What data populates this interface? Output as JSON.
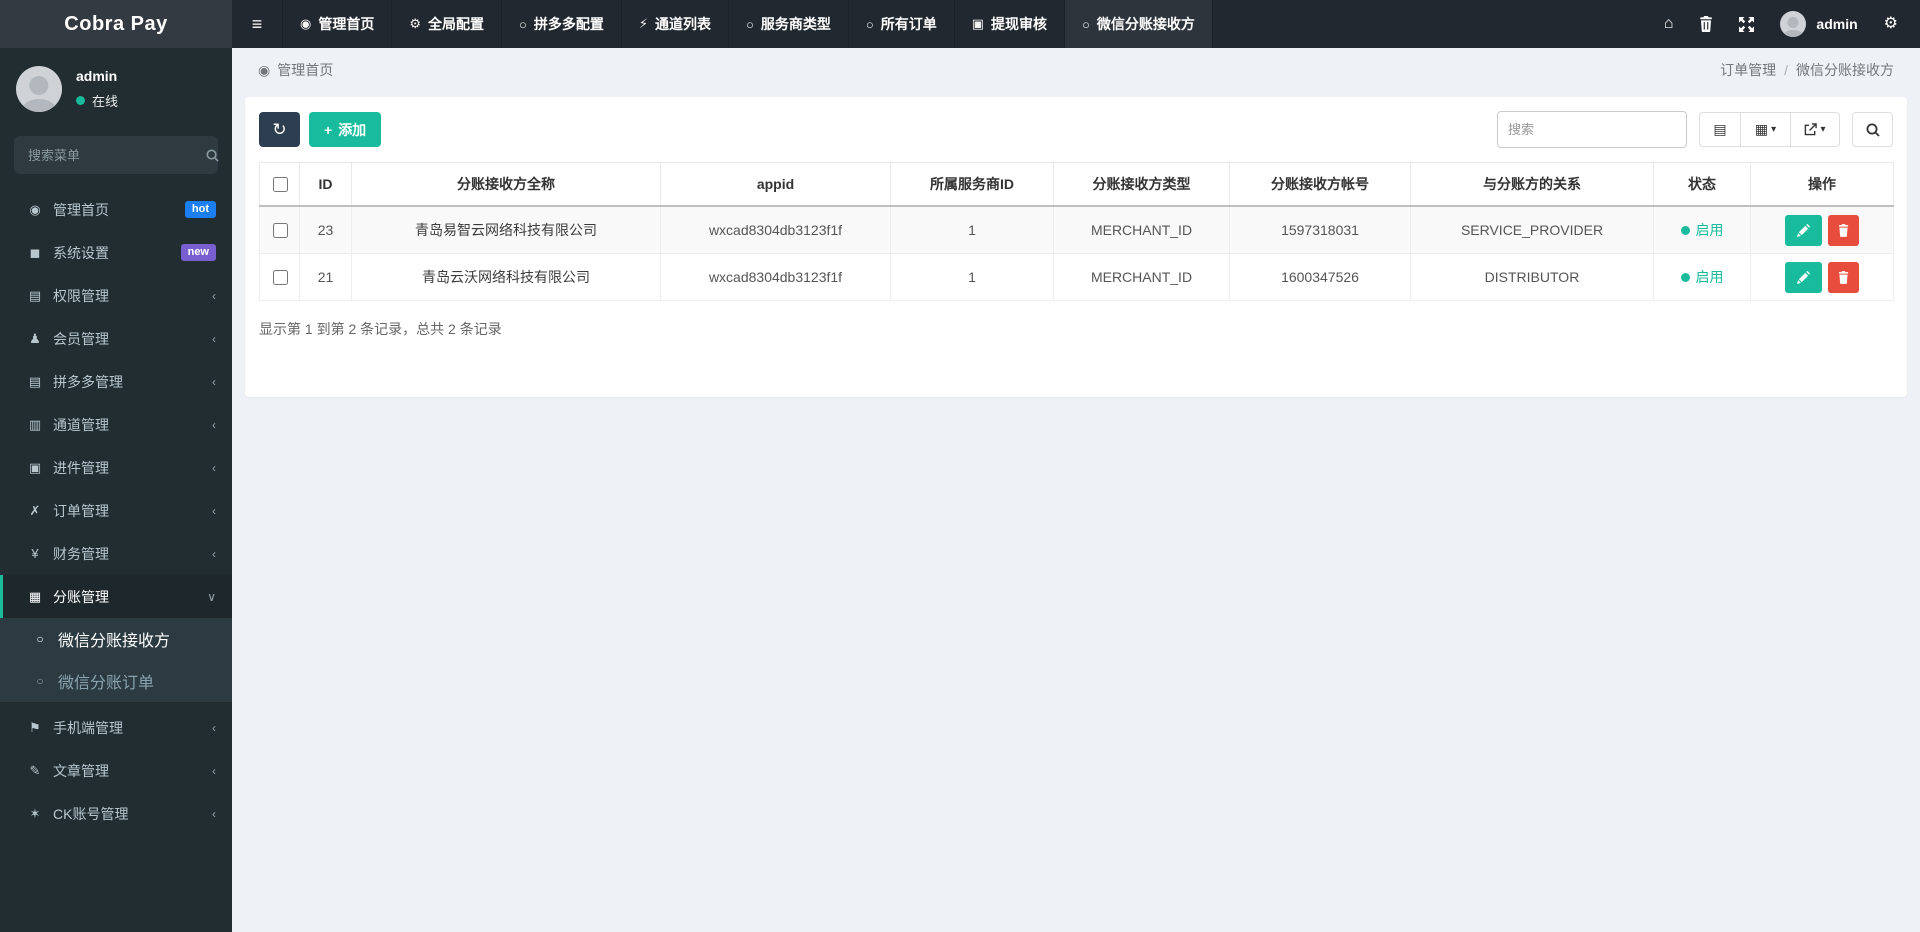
{
  "brand": {
    "title": "Cobra Pay"
  },
  "topbar": {
    "menu_icon": "≡",
    "tabs": [
      {
        "label": "管理首页",
        "icon": "◉"
      },
      {
        "label": "全局配置",
        "icon": "⚙"
      },
      {
        "label": "拼多多配置",
        "icon": "○"
      },
      {
        "label": "通道列表",
        "icon": "⚡"
      },
      {
        "label": "服务商类型",
        "icon": "○"
      },
      {
        "label": "所有订单",
        "icon": "○"
      },
      {
        "label": "提现审核",
        "icon": "▣"
      },
      {
        "label": "微信分账接收方",
        "icon": "○"
      }
    ],
    "active_tab": "微信分账接收方",
    "home_icon": "⌂",
    "gear_icon": "⚙",
    "username": "admin"
  },
  "sidebar": {
    "user": {
      "name": "admin",
      "status": "在线"
    },
    "search_placeholder": "搜索菜单",
    "items": [
      {
        "label": "管理首页",
        "icon": "◉",
        "badge": "hot"
      },
      {
        "label": "系统设置",
        "icon": "◼",
        "badge": "new"
      },
      {
        "label": "权限管理",
        "icon": "▤",
        "chevron": "‹"
      },
      {
        "label": "会员管理",
        "icon": "♟",
        "chevron": "‹"
      },
      {
        "label": "拼多多管理",
        "icon": "▤",
        "chevron": "‹"
      },
      {
        "label": "通道管理",
        "icon": "▥",
        "chevron": "‹"
      },
      {
        "label": "进件管理",
        "icon": "▣",
        "chevron": "‹"
      },
      {
        "label": "订单管理",
        "icon": "✗",
        "chevron": "‹"
      },
      {
        "label": "财务管理",
        "icon": "¥",
        "chevron": "‹"
      },
      {
        "label": "分账管理",
        "icon": "▦",
        "chevron": "∨",
        "active": true
      },
      {
        "label": "手机端管理",
        "icon": "⚑",
        "chevron": "‹"
      },
      {
        "label": "文章管理",
        "icon": "✎",
        "chevron": "‹"
      },
      {
        "label": "CK账号管理",
        "icon": "✶",
        "chevron": "‹"
      }
    ],
    "submenu": [
      {
        "label": "微信分账接收方",
        "icon": "○",
        "active": true
      },
      {
        "label": "微信分账订单",
        "icon": "○",
        "active": false
      }
    ]
  },
  "breadcrumb": {
    "home_icon": "◉",
    "left": "管理首页",
    "parent": "订单管理",
    "separator": "/",
    "current": "微信分账接收方"
  },
  "toolbar": {
    "refresh_icon": "↻",
    "add_plus": "+",
    "add_label": "添加",
    "search_placeholder": "搜索",
    "detail_icon": "▤",
    "columns_icon": "▦",
    "caret": "▾"
  },
  "table": {
    "columns": [
      "ID",
      "分账接收方全称",
      "appid",
      "所属服务商ID",
      "分账接收方类型",
      "分账接收方帐号",
      "与分账方的关系",
      "状态",
      "操作"
    ],
    "rows": [
      {
        "id": "23",
        "name": "青岛易智云网络科技有限公司",
        "appid": "wxcad8304db3123f1f",
        "provider_id": "1",
        "type": "MERCHANT_ID",
        "account": "1597318031",
        "relation": "SERVICE_PROVIDER",
        "status": "启用"
      },
      {
        "id": "21",
        "name": "青岛云沃网络科技有限公司",
        "appid": "wxcad8304db3123f1f",
        "provider_id": "1",
        "type": "MERCHANT_ID",
        "account": "1600347526",
        "relation": "DISTRIBUTOR",
        "status": "启用"
      }
    ],
    "summary": "显示第 1 到第 2 条记录，总共 2 条记录"
  },
  "colors": {
    "accent": "#18bc9c",
    "danger": "#e74c3c",
    "dark_button": "#2c3e50",
    "hot_badge": "#1b7ef2",
    "new_badge": "#7a5fd0",
    "sidebar_bg": "#222d32",
    "topbar_bg": "#22282f"
  }
}
